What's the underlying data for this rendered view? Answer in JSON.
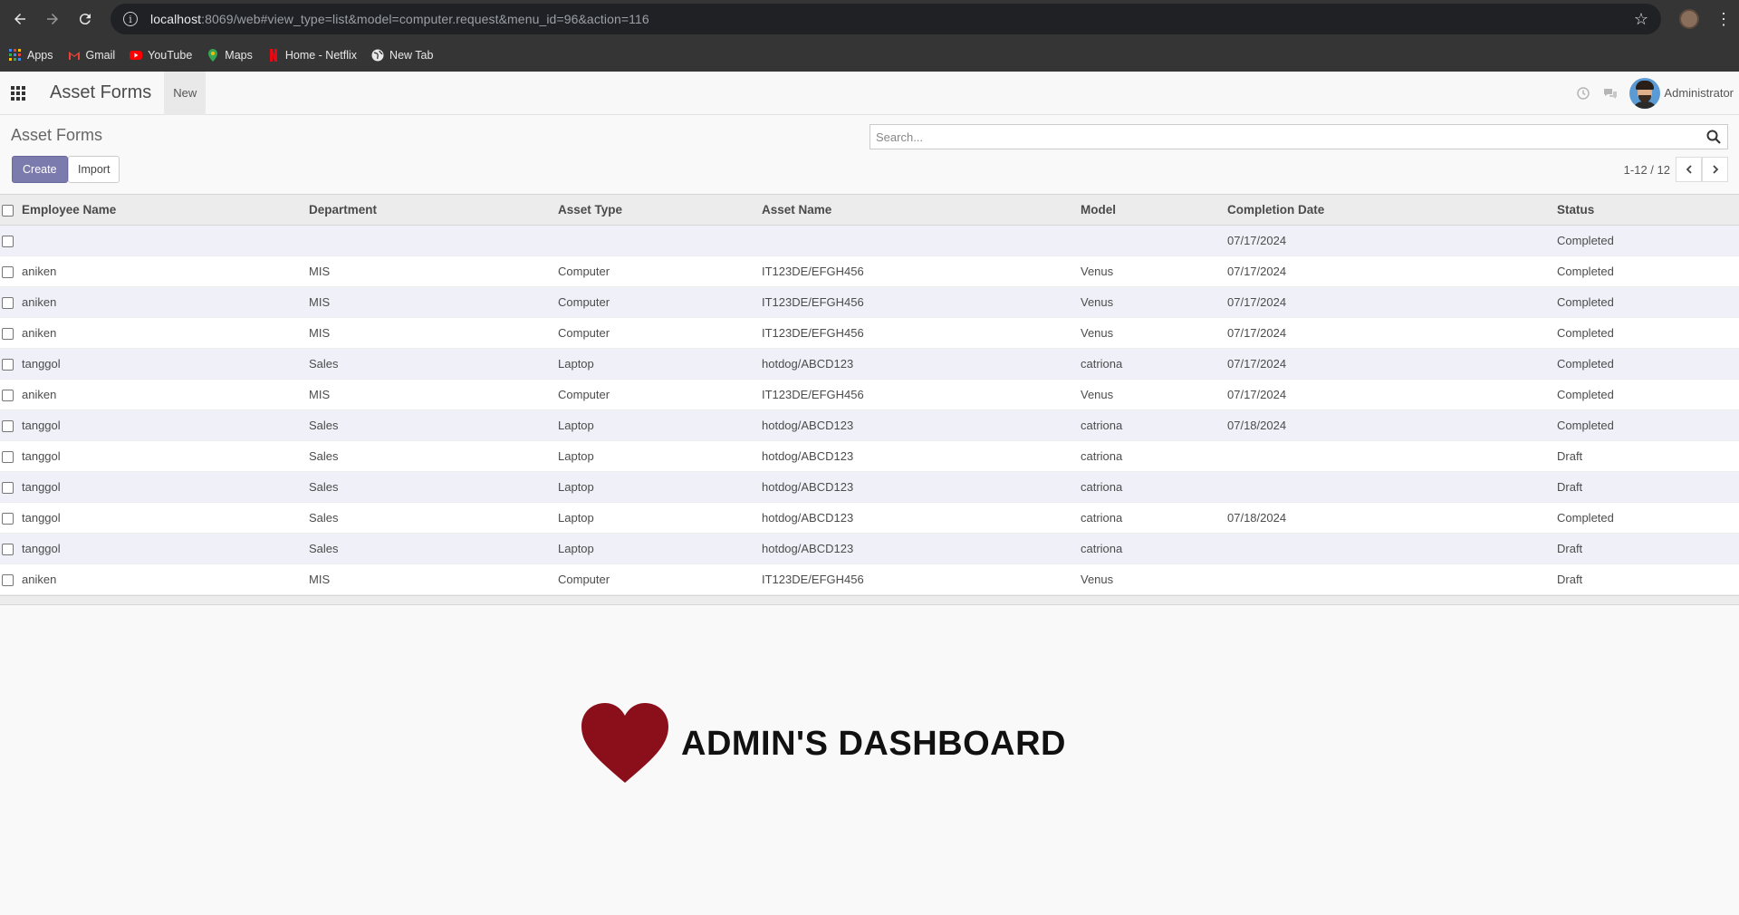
{
  "browser": {
    "url_host": "localhost",
    "url_rest": ":8069/web#view_type=list&model=computer.request&menu_id=96&action=116",
    "bookmarks": [
      {
        "label": "Apps",
        "icon": "apps-grid-icon",
        "color": "#4285f4"
      },
      {
        "label": "Gmail",
        "icon": "gmail-icon",
        "color": "#ea4335"
      },
      {
        "label": "YouTube",
        "icon": "youtube-icon",
        "color": "#ff0000"
      },
      {
        "label": "Maps",
        "icon": "maps-icon",
        "color": "#34a853"
      },
      {
        "label": "Home - Netflix",
        "icon": "netflix-icon",
        "color": "#e50914"
      },
      {
        "label": "New Tab",
        "icon": "globe-icon",
        "color": "#e8e8e8"
      }
    ]
  },
  "navbar": {
    "app_title": "Asset Forms",
    "menu_new": "New",
    "user_name": "Administrator"
  },
  "control": {
    "breadcrumb": "Asset Forms",
    "search_placeholder": "Search...",
    "create_label": "Create",
    "import_label": "Import",
    "pager": "1-12 / 12"
  },
  "table": {
    "columns": [
      "Employee Name",
      "Department",
      "Asset Type",
      "Asset Name",
      "Model",
      "Completion Date",
      "Status"
    ],
    "rows": [
      [
        "",
        "",
        "",
        "",
        "",
        "07/17/2024",
        "Completed"
      ],
      [
        "aniken",
        "MIS",
        "Computer",
        "IT123DE/EFGH456",
        "Venus",
        "07/17/2024",
        "Completed"
      ],
      [
        "aniken",
        "MIS",
        "Computer",
        "IT123DE/EFGH456",
        "Venus",
        "07/17/2024",
        "Completed"
      ],
      [
        "aniken",
        "MIS",
        "Computer",
        "IT123DE/EFGH456",
        "Venus",
        "07/17/2024",
        "Completed"
      ],
      [
        "tanggol",
        "Sales",
        "Laptop",
        "hotdog/ABCD123",
        "catriona",
        "07/17/2024",
        "Completed"
      ],
      [
        "aniken",
        "MIS",
        "Computer",
        "IT123DE/EFGH456",
        "Venus",
        "07/17/2024",
        "Completed"
      ],
      [
        "tanggol",
        "Sales",
        "Laptop",
        "hotdog/ABCD123",
        "catriona",
        "07/18/2024",
        "Completed"
      ],
      [
        "tanggol",
        "Sales",
        "Laptop",
        "hotdog/ABCD123",
        "catriona",
        "",
        "Draft"
      ],
      [
        "tanggol",
        "Sales",
        "Laptop",
        "hotdog/ABCD123",
        "catriona",
        "",
        "Draft"
      ],
      [
        "tanggol",
        "Sales",
        "Laptop",
        "hotdog/ABCD123",
        "catriona",
        "07/18/2024",
        "Completed"
      ],
      [
        "tanggol",
        "Sales",
        "Laptop",
        "hotdog/ABCD123",
        "catriona",
        "",
        "Draft"
      ],
      [
        "aniken",
        "MIS",
        "Computer",
        "IT123DE/EFGH456",
        "Venus",
        "",
        "Draft"
      ]
    ]
  },
  "dashboard": {
    "title": "ADMIN'S DASHBOARD",
    "heart_color": "#8b0f1a"
  }
}
